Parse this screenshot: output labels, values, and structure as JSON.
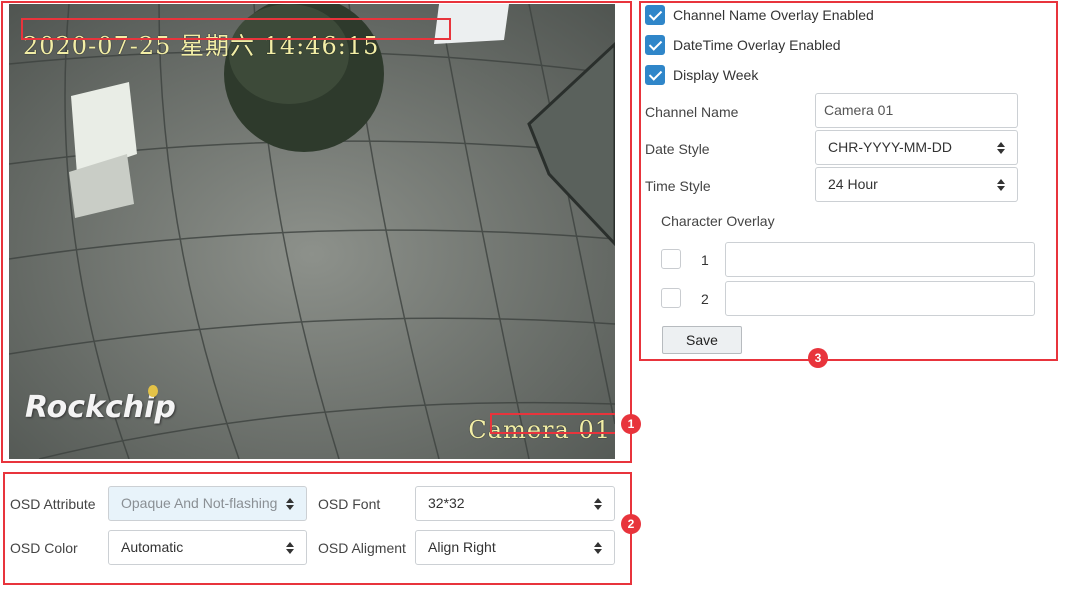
{
  "preview": {
    "osd_datetime": "2020-07-25 星期六 14:46:15",
    "osd_channel": "Camera 01",
    "logo": "Rockchip"
  },
  "badges": {
    "preview": "1",
    "attributes": "2",
    "settings": "3"
  },
  "attributes": {
    "osd_attribute_label": "OSD Attribute",
    "osd_attribute_value": "Opaque And Not-flashing",
    "osd_font_label": "OSD Font",
    "osd_font_value": "32*32",
    "osd_color_label": "OSD Color",
    "osd_color_value": "Automatic",
    "osd_alignment_label": "OSD Aligment",
    "osd_alignment_value": "Align Right"
  },
  "settings": {
    "checkboxes": [
      {
        "label": "Channel Name Overlay Enabled",
        "checked": true
      },
      {
        "label": "DateTime Overlay Enabled",
        "checked": true
      },
      {
        "label": "Display Week",
        "checked": true
      }
    ],
    "channel_name_label": "Channel Name",
    "channel_name_value": "Camera 01",
    "date_style_label": "Date Style",
    "date_style_value": "CHR-YYYY-MM-DD",
    "time_style_label": "Time Style",
    "time_style_value": "24 Hour",
    "character_overlay_label": "Character Overlay",
    "overlay_rows": [
      {
        "index": "1",
        "checked": false,
        "value": ""
      },
      {
        "index": "2",
        "checked": false,
        "value": ""
      }
    ],
    "save_label": "Save"
  },
  "colors": {
    "highlight": "#e8343c",
    "accent": "#2f86c9",
    "osd_text": "#f2eea6"
  }
}
